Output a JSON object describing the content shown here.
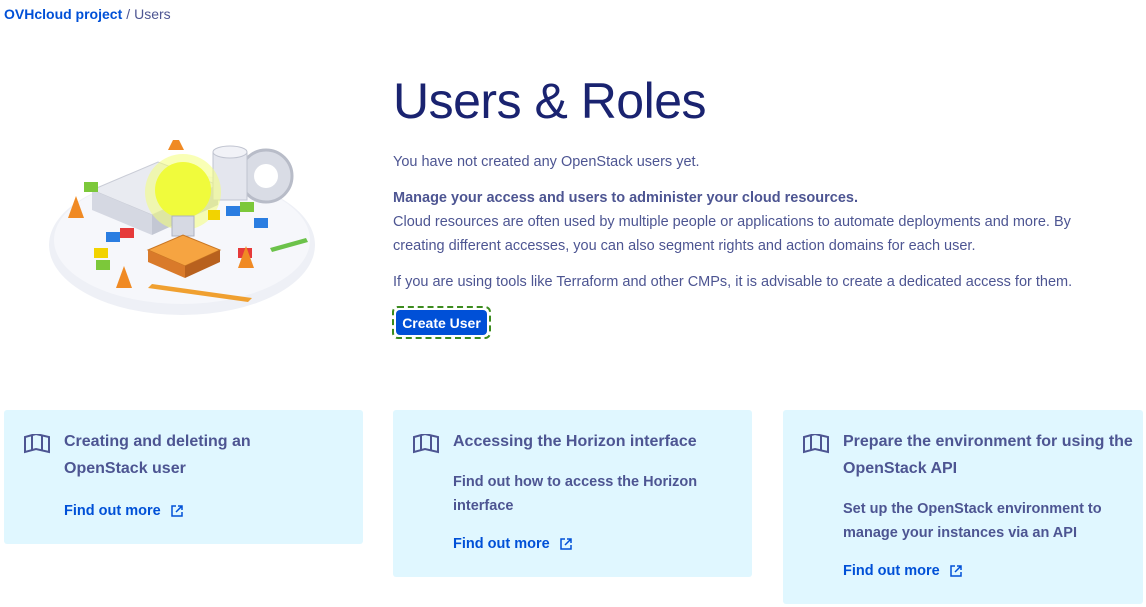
{
  "breadcrumb": {
    "project": "OVHcloud project",
    "separator": "/",
    "current": "Users"
  },
  "hero": {
    "title": "Users & Roles",
    "intro": "You have not created any OpenStack users yet.",
    "strong": "Manage your access and users to administer your cloud resources.",
    "body": "Cloud resources are often used by multiple people or applications to automate deployments and more. By creating different accesses, you can also segment rights and action domains for each user.",
    "tools": "If you are using tools like Terraform and other CMPs, it is advisable to create a dedicated access for them."
  },
  "create_button": {
    "label": "Create User"
  },
  "cards": [
    {
      "title": "Creating and deleting an OpenStack user",
      "description": "",
      "link": "Find out more",
      "icon": "book-icon"
    },
    {
      "title": "Accessing the Horizon interface",
      "description": "Find out how to access the Horizon interface",
      "link": "Find out more",
      "icon": "book-icon"
    },
    {
      "title": "Prepare the environment for using the OpenStack API",
      "description": "Set up the OpenStack environment to manage your instances via an API",
      "link": "Find out more",
      "icon": "book-icon"
    }
  ],
  "colors": {
    "primary": "#0050d7",
    "text": "#4d5592",
    "heading": "#1a2370",
    "card_bg": "#e0f7ff",
    "focus_outline": "#3c8c1e"
  }
}
